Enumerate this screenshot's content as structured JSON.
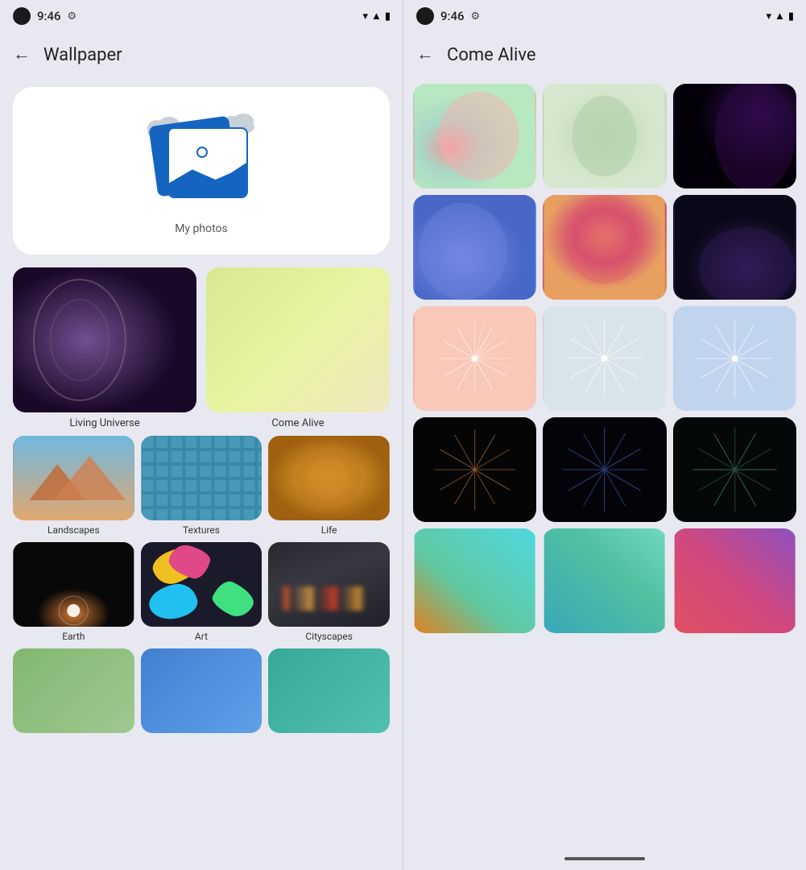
{
  "left": {
    "statusBar": {
      "time": "9:46",
      "settingsIcon": "⚙",
      "wifiIcon": "▾",
      "signalIcon": "▲",
      "batteryIcon": "▮"
    },
    "appBar": {
      "backLabel": "←",
      "title": "Wallpaper"
    },
    "myPhotos": {
      "label": "My photos"
    },
    "categories": [
      {
        "id": "living-universe",
        "label": "Living Universe"
      },
      {
        "id": "come-alive",
        "label": "Come Alive"
      }
    ],
    "grid3": [
      {
        "id": "landscapes",
        "label": "Landscapes"
      },
      {
        "id": "textures",
        "label": "Textures"
      },
      {
        "id": "life",
        "label": "Life"
      },
      {
        "id": "earth",
        "label": "Earth"
      },
      {
        "id": "art",
        "label": "Art"
      },
      {
        "id": "cityscapes",
        "label": "Cityscapes"
      }
    ],
    "partialRow": [
      {
        "id": "partial1",
        "label": ""
      },
      {
        "id": "partial2",
        "label": ""
      },
      {
        "id": "partial3",
        "label": ""
      }
    ]
  },
  "right": {
    "statusBar": {
      "time": "9:46",
      "settingsIcon": "⚙"
    },
    "appBar": {
      "backLabel": "←",
      "title": "Come Alive"
    },
    "wallpapers": [
      {
        "id": "wp1",
        "cssClass": "wp-teal-peach"
      },
      {
        "id": "wp2",
        "cssClass": "wp-green-gray"
      },
      {
        "id": "wp3",
        "cssClass": "wp-dark-purple"
      },
      {
        "id": "wp4",
        "cssClass": "wp-blue-grad"
      },
      {
        "id": "wp5",
        "cssClass": "wp-red-coral"
      },
      {
        "id": "wp6",
        "cssClass": "wp-dark-navy"
      },
      {
        "id": "wp7",
        "cssClass": "wp-peach-spark"
      },
      {
        "id": "wp8",
        "cssClass": "wp-gray-spark"
      },
      {
        "id": "wp9",
        "cssClass": "wp-blue-spark"
      },
      {
        "id": "wp10",
        "cssClass": "wp-dark-firework"
      },
      {
        "id": "wp11",
        "cssClass": "wp-dark-firework2"
      },
      {
        "id": "wp12",
        "cssClass": "wp-dark-green-fw"
      },
      {
        "id": "wp13",
        "cssClass": "wp-teal-grad"
      },
      {
        "id": "wp14",
        "cssClass": "wp-teal-grad2"
      },
      {
        "id": "wp15",
        "cssClass": "wp-sunset"
      }
    ]
  }
}
